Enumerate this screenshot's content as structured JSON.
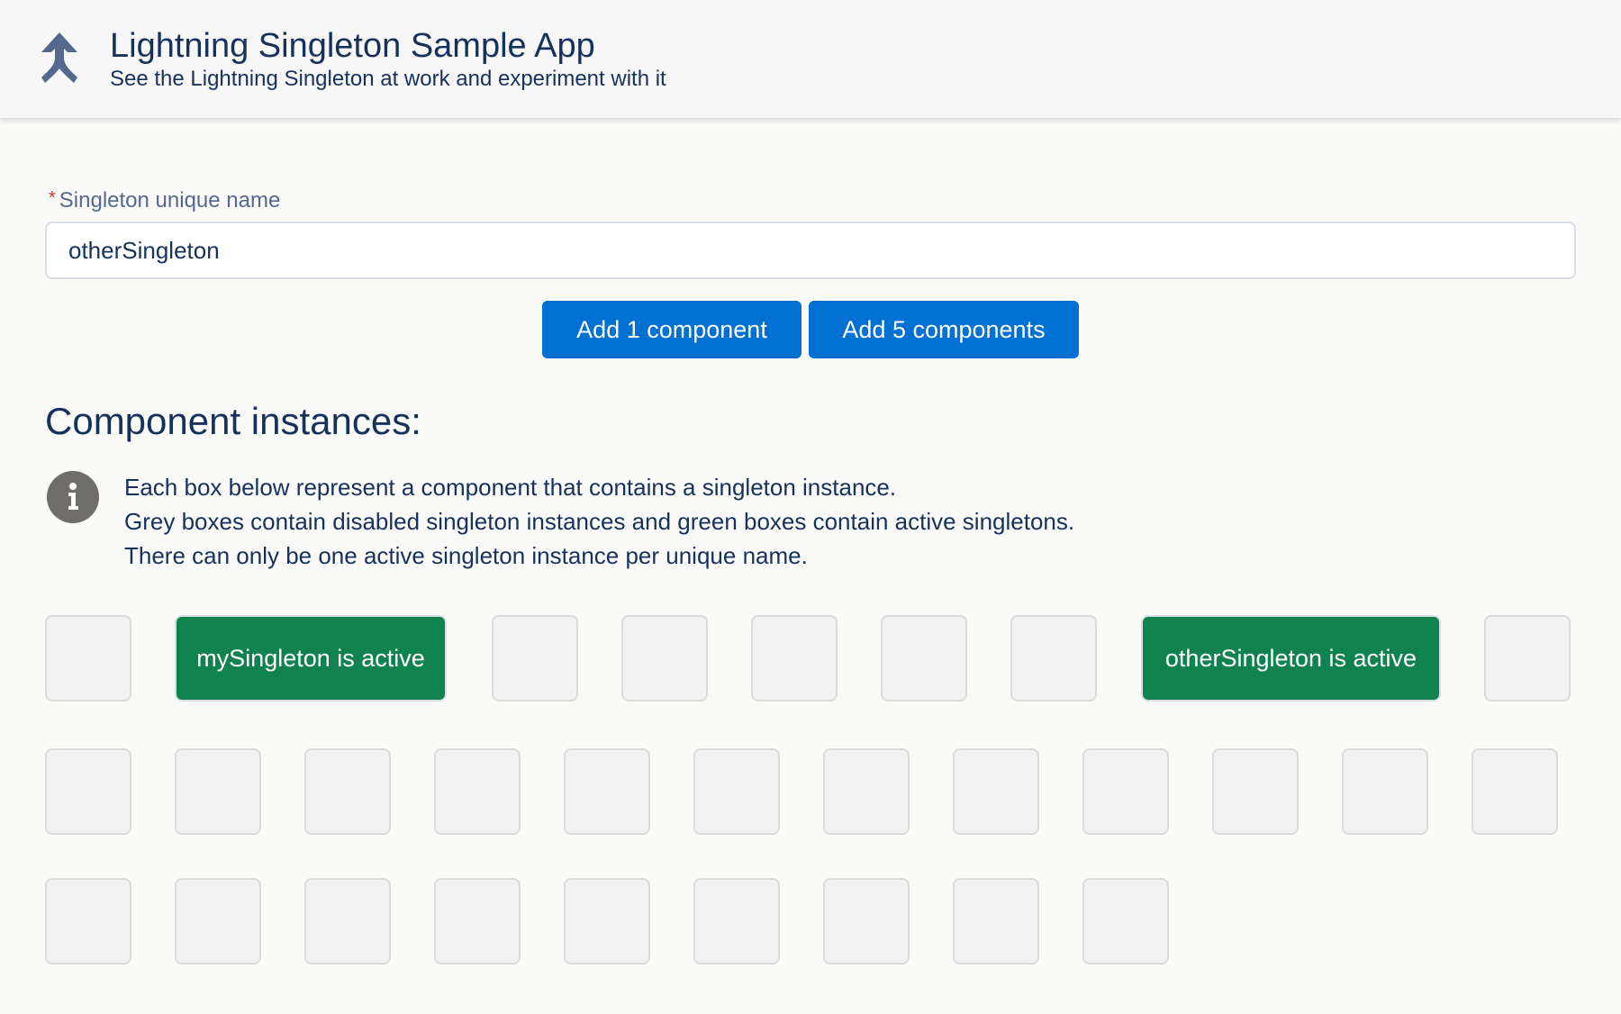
{
  "header": {
    "title": "Lightning Singleton Sample App",
    "subtitle": "See the Lightning Singleton at work and experiment with it",
    "icon": "merge-arrow-icon"
  },
  "form": {
    "required_marker": "*",
    "label": "Singleton unique name",
    "value": "otherSingleton"
  },
  "buttons": {
    "add_one": "Add 1 component",
    "add_five": "Add 5 components"
  },
  "instances": {
    "title": "Component instances:",
    "info_icon": "info-icon",
    "info_lines": [
      "Each box below represent a component that contains a singleton instance.",
      "Grey boxes contain disabled singleton instances and green boxes contain active singletons.",
      "There can only be one active singleton instance per unique name."
    ],
    "active_labels": {
      "my": "mySingleton is active",
      "other": "otherSingleton is active"
    }
  },
  "colors": {
    "brand_blue": "#0070d2",
    "active_green": "#10824e",
    "disabled_grey": "#f2f2f2",
    "text_navy": "#16325c"
  }
}
